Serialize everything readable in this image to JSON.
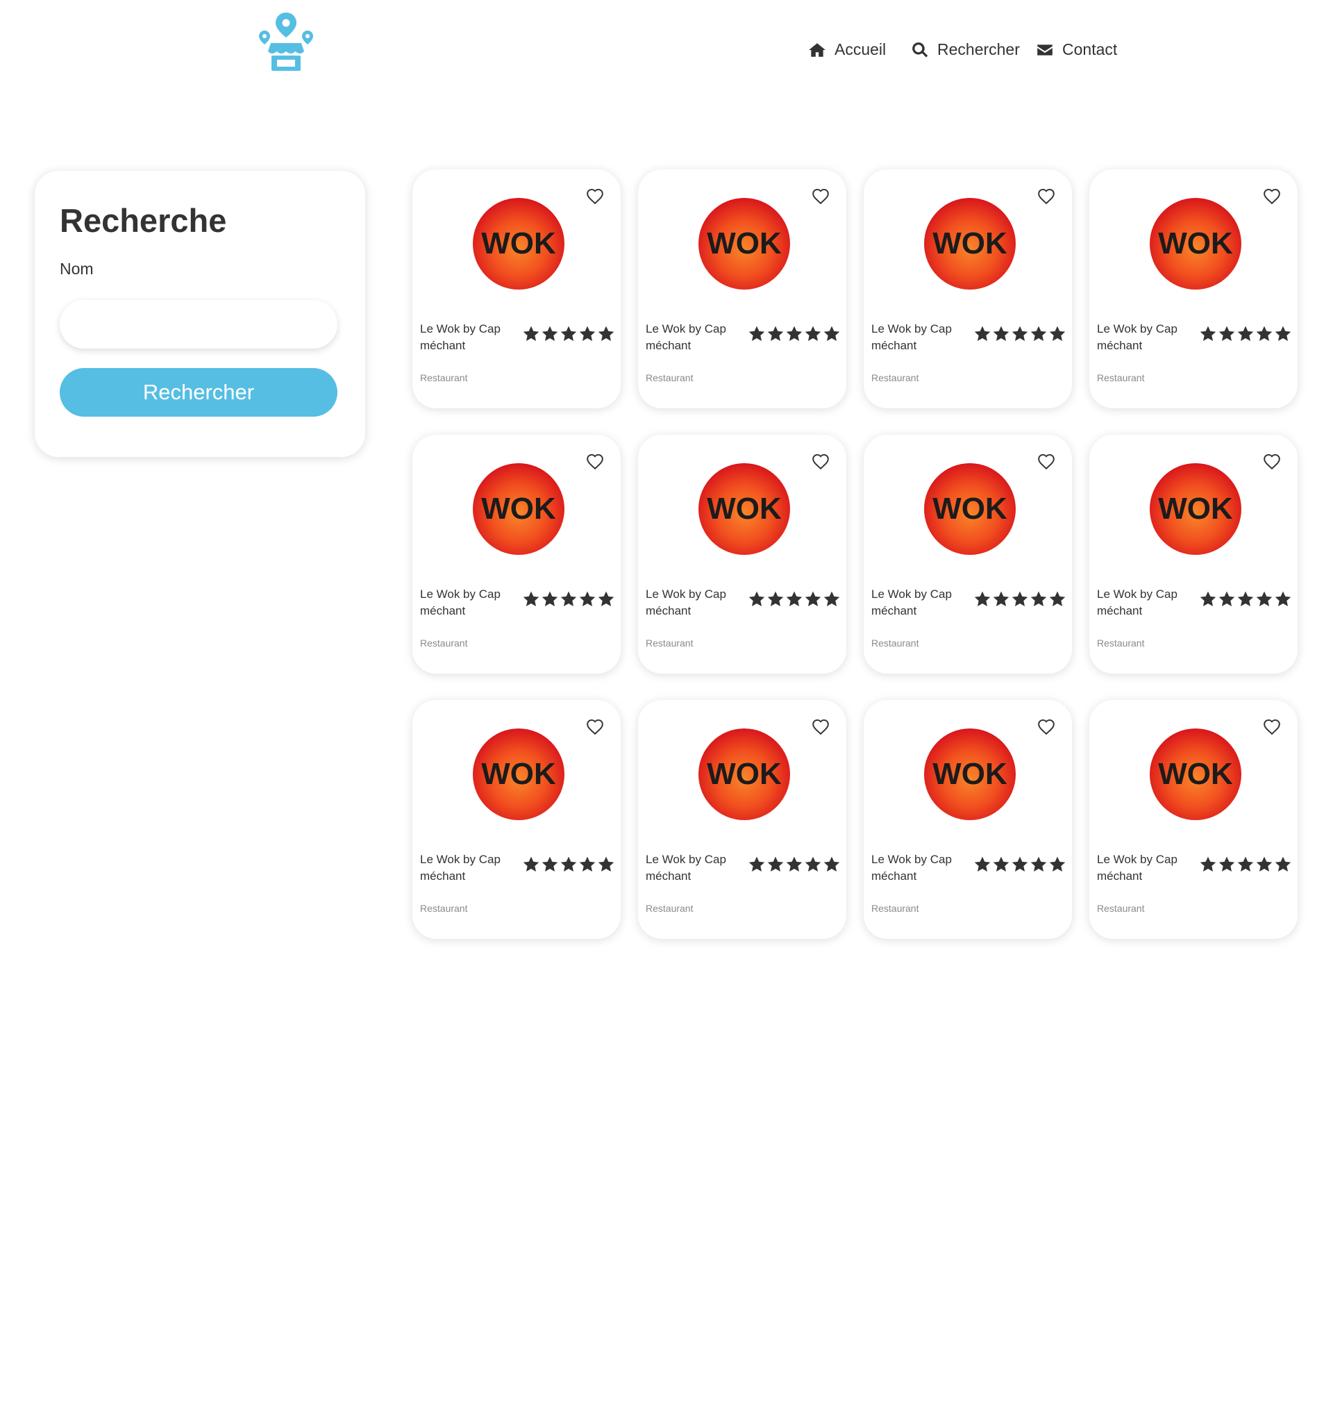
{
  "header": {
    "logo_icon": "store-map-pin-logo",
    "brand_color": "#56bee3",
    "nav": [
      {
        "label": "Accueil",
        "icon": "home-icon"
      },
      {
        "label": "Rechercher",
        "icon": "search-icon"
      },
      {
        "label": "Contact",
        "icon": "envelope-icon"
      }
    ]
  },
  "search": {
    "title": "Recherche",
    "name_label": "Nom",
    "name_value": "",
    "button_label": "Rechercher"
  },
  "cards": [
    {
      "name": "Le Wok by Cap méchant",
      "category": "Restaurant",
      "rating": 5,
      "logo_text": "WOK",
      "favorite": false
    },
    {
      "name": "Le Wok by Cap méchant",
      "category": "Restaurant",
      "rating": 5,
      "logo_text": "WOK",
      "favorite": false
    },
    {
      "name": "Le Wok by Cap méchant",
      "category": "Restaurant",
      "rating": 5,
      "logo_text": "WOK",
      "favorite": false
    },
    {
      "name": "Le Wok by Cap méchant",
      "category": "Restaurant",
      "rating": 5,
      "logo_text": "WOK",
      "favorite": false
    },
    {
      "name": "Le Wok by Cap méchant",
      "category": "Restaurant",
      "rating": 5,
      "logo_text": "WOK",
      "favorite": false
    },
    {
      "name": "Le Wok by Cap méchant",
      "category": "Restaurant",
      "rating": 5,
      "logo_text": "WOK",
      "favorite": false
    },
    {
      "name": "Le Wok by Cap méchant",
      "category": "Restaurant",
      "rating": 5,
      "logo_text": "WOK",
      "favorite": false
    },
    {
      "name": "Le Wok by Cap méchant",
      "category": "Restaurant",
      "rating": 5,
      "logo_text": "WOK",
      "favorite": false
    },
    {
      "name": "Le Wok by Cap méchant",
      "category": "Restaurant",
      "rating": 5,
      "logo_text": "WOK",
      "favorite": false
    },
    {
      "name": "Le Wok by Cap méchant",
      "category": "Restaurant",
      "rating": 5,
      "logo_text": "WOK",
      "favorite": false
    },
    {
      "name": "Le Wok by Cap méchant",
      "category": "Restaurant",
      "rating": 5,
      "logo_text": "WOK",
      "favorite": false
    },
    {
      "name": "Le Wok by Cap méchant",
      "category": "Restaurant",
      "rating": 5,
      "logo_text": "WOK",
      "favorite": false
    }
  ]
}
